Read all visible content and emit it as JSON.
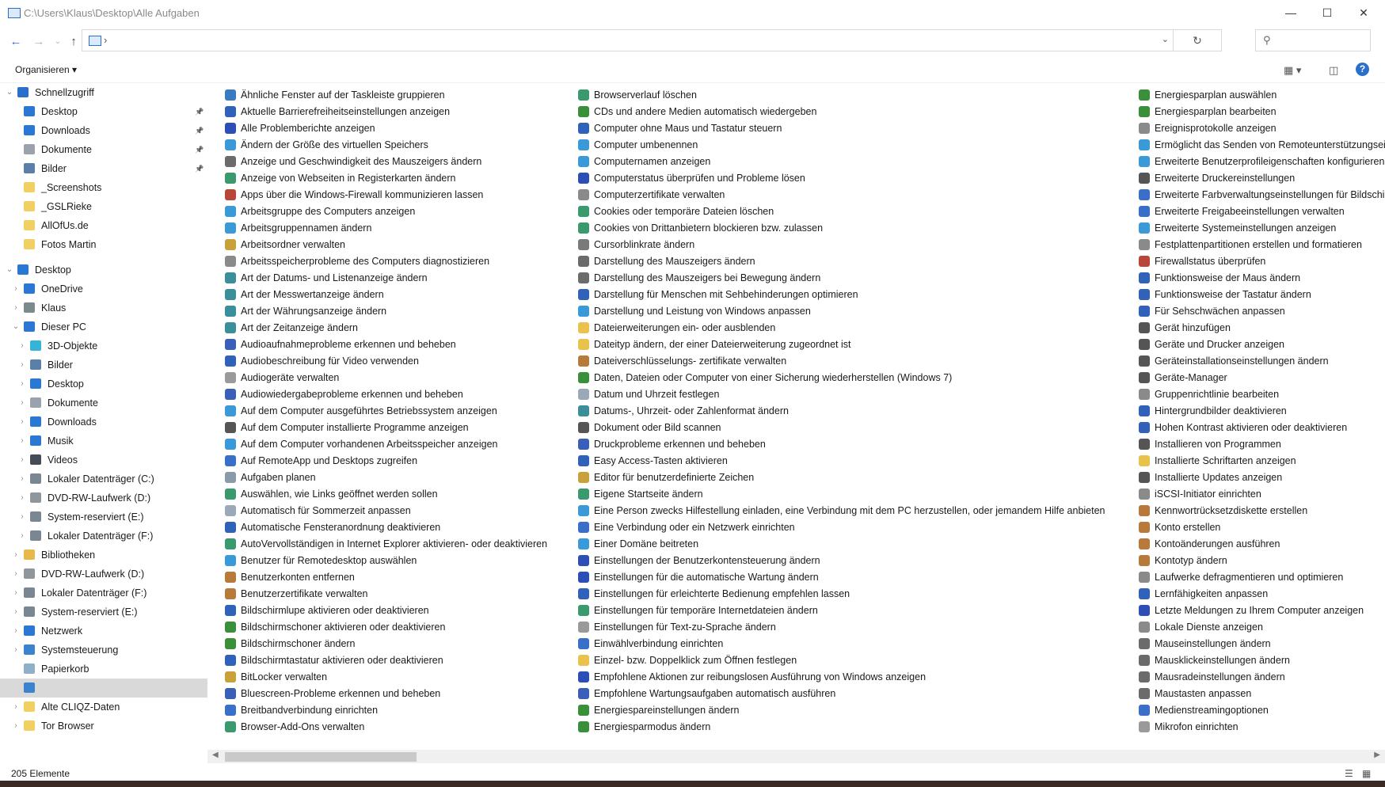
{
  "window": {
    "title": "C:\\Users\\Klaus\\Desktop\\Alle Aufgaben"
  },
  "address": {
    "separator": "›"
  },
  "toolbar": {
    "organize_label": "Organisieren ▾"
  },
  "nav": {
    "items": [
      {
        "label": "Schnellzugriff",
        "indent": 0,
        "chevron": "⌄",
        "icon": "star-icon",
        "color": "#2a6fc9",
        "pin": false
      },
      {
        "label": "Desktop",
        "indent": 1,
        "chevron": "",
        "icon": "desktop-icon",
        "color": "#2a78d4",
        "pin": true
      },
      {
        "label": "Downloads",
        "indent": 1,
        "chevron": "",
        "icon": "download-icon",
        "color": "#2a78d4",
        "pin": true
      },
      {
        "label": "Dokumente",
        "indent": 1,
        "chevron": "",
        "icon": "document-icon",
        "color": "#9aa3ad",
        "pin": true
      },
      {
        "label": "Bilder",
        "indent": 1,
        "chevron": "",
        "icon": "pictures-icon",
        "color": "#5a7fa8",
        "pin": true
      },
      {
        "label": "_Screenshots",
        "indent": 1,
        "chevron": "",
        "icon": "folder-icon",
        "color": "#f1cf63",
        "pin": false
      },
      {
        "label": "_GSLRieke",
        "indent": 1,
        "chevron": "",
        "icon": "folder-icon",
        "color": "#f1cf63",
        "pin": false
      },
      {
        "label": "AllOfUs.de",
        "indent": 1,
        "chevron": "",
        "icon": "folder-icon",
        "color": "#f1cf63",
        "pin": false
      },
      {
        "label": "Fotos Martin",
        "indent": 1,
        "chevron": "",
        "icon": "folder-icon",
        "color": "#f1cf63",
        "pin": false
      },
      {
        "label": "Desktop",
        "indent": 0,
        "chevron": "⌄",
        "icon": "desktop-icon",
        "color": "#2a78d4",
        "pin": false,
        "gap": true
      },
      {
        "label": "OneDrive",
        "indent": 1,
        "chevron": "›",
        "icon": "cloud-icon",
        "color": "#2a78d4",
        "pin": false
      },
      {
        "label": "Klaus",
        "indent": 1,
        "chevron": "›",
        "icon": "user-icon",
        "color": "#7b8a8c",
        "pin": false
      },
      {
        "label": "Dieser PC",
        "indent": 1,
        "chevron": "⌄",
        "icon": "computer-icon",
        "color": "#2a78d4",
        "pin": false
      },
      {
        "label": "3D-Objekte",
        "indent": 2,
        "chevron": "›",
        "icon": "cube-icon",
        "color": "#36b3d9",
        "pin": false
      },
      {
        "label": "Bilder",
        "indent": 2,
        "chevron": "›",
        "icon": "pictures-icon",
        "color": "#5a7fa8",
        "pin": false
      },
      {
        "label": "Desktop",
        "indent": 2,
        "chevron": "›",
        "icon": "desktop-icon",
        "color": "#2a78d4",
        "pin": false
      },
      {
        "label": "Dokumente",
        "indent": 2,
        "chevron": "›",
        "icon": "document-icon",
        "color": "#9aa3ad",
        "pin": false
      },
      {
        "label": "Downloads",
        "indent": 2,
        "chevron": "›",
        "icon": "download-icon",
        "color": "#2a78d4",
        "pin": false
      },
      {
        "label": "Musik",
        "indent": 2,
        "chevron": "›",
        "icon": "music-icon",
        "color": "#2a78d4",
        "pin": false
      },
      {
        "label": "Videos",
        "indent": 2,
        "chevron": "›",
        "icon": "video-icon",
        "color": "#444c55",
        "pin": false
      },
      {
        "label": "Lokaler Datenträger (C:)",
        "indent": 2,
        "chevron": "›",
        "icon": "drive-icon",
        "color": "#7a8691",
        "pin": false
      },
      {
        "label": "DVD-RW-Laufwerk (D:)",
        "indent": 2,
        "chevron": "›",
        "icon": "dvd-icon",
        "color": "#8f969c",
        "pin": false
      },
      {
        "label": "System-reserviert (E:)",
        "indent": 2,
        "chevron": "›",
        "icon": "drive-icon",
        "color": "#7a8691",
        "pin": false
      },
      {
        "label": "Lokaler Datenträger (F:)",
        "indent": 2,
        "chevron": "›",
        "icon": "drive-icon",
        "color": "#7a8691",
        "pin": false
      },
      {
        "label": "Bibliotheken",
        "indent": 1,
        "chevron": "›",
        "icon": "library-icon",
        "color": "#e8b94a",
        "pin": false
      },
      {
        "label": "DVD-RW-Laufwerk (D:)",
        "indent": 1,
        "chevron": "›",
        "icon": "dvd-icon",
        "color": "#8f969c",
        "pin": false
      },
      {
        "label": "Lokaler Datenträger (F:)",
        "indent": 1,
        "chevron": "›",
        "icon": "drive-icon",
        "color": "#7a8691",
        "pin": false
      },
      {
        "label": "System-reserviert (E:)",
        "indent": 1,
        "chevron": "›",
        "icon": "drive-icon",
        "color": "#7a8691",
        "pin": false
      },
      {
        "label": "Netzwerk",
        "indent": 1,
        "chevron": "›",
        "icon": "network-icon",
        "color": "#2a78d4",
        "pin": false
      },
      {
        "label": "Systemsteuerung",
        "indent": 1,
        "chevron": "›",
        "icon": "control-panel-icon",
        "color": "#3b83cc",
        "pin": false
      },
      {
        "label": "Papierkorb",
        "indent": 1,
        "chevron": "",
        "icon": "recycle-bin-icon",
        "color": "#8fb0c9",
        "pin": false
      },
      {
        "label": "",
        "indent": 1,
        "chevron": "",
        "icon": "control-panel-icon",
        "color": "#3b83cc",
        "pin": false,
        "selected": true
      },
      {
        "label": "Alte CLIQZ-Daten",
        "indent": 1,
        "chevron": "›",
        "icon": "folder-icon",
        "color": "#f1cf63",
        "pin": false
      },
      {
        "label": "Tor Browser",
        "indent": 1,
        "chevron": "›",
        "icon": "folder-icon",
        "color": "#f1cf63",
        "pin": false
      }
    ]
  },
  "columns": [
    {
      "items": [
        {
          "label": "Ähnliche Fenster auf der Taskleiste gruppieren",
          "color": "#3a7ac2"
        },
        {
          "label": "Aktuelle Barrierefreiheitseinstellungen anzeigen",
          "color": "#2f62b8"
        },
        {
          "label": "Alle Problemberichte anzeigen",
          "color": "#2d4fb5"
        },
        {
          "label": "Ändern der Größe des virtuellen Speichers",
          "color": "#3a9ad8"
        },
        {
          "label": "Anzeige und Geschwindigkeit des Mauszeigers ändern",
          "color": "#6b6b6b"
        },
        {
          "label": "Anzeige von Webseiten in Registerkarten ändern",
          "color": "#3a9a6e"
        },
        {
          "label": "Apps über die Windows-Firewall kommunizieren lassen",
          "color": "#b8473a"
        },
        {
          "label": "Arbeitsgruppe des Computers anzeigen",
          "color": "#3a9ad8"
        },
        {
          "label": "Arbeitsgruppennamen ändern",
          "color": "#3a9ad8"
        },
        {
          "label": "Arbeitsordner verwalten",
          "color": "#c9a13a"
        },
        {
          "label": "Arbeitsspeicherprobleme des Computers diagnostizieren",
          "color": "#8a8a8a"
        },
        {
          "label": "Art der Datums- und Listenanzeige ändern",
          "color": "#3a8f9a"
        },
        {
          "label": "Art der Messwertanzeige ändern",
          "color": "#3a8f9a"
        },
        {
          "label": "Art der Währungsanzeige ändern",
          "color": "#3a8f9a"
        },
        {
          "label": "Art der Zeitanzeige ändern",
          "color": "#3a8f9a"
        },
        {
          "label": "Audioaufnahmeprobleme erkennen und beheben",
          "color": "#3a5fb8"
        },
        {
          "label": "Audiobeschreibung für Video verwenden",
          "color": "#2f62b8"
        },
        {
          "label": "Audiogeräte verwalten",
          "color": "#9a9a9a"
        },
        {
          "label": "Audiowiedergabeprobleme erkennen und beheben",
          "color": "#3a5fb8"
        },
        {
          "label": "Auf dem Computer ausgeführtes Betriebssystem anzeigen",
          "color": "#3a9ad8"
        },
        {
          "label": "Auf dem Computer installierte Programme anzeigen",
          "color": "#555555"
        },
        {
          "label": "Auf dem Computer vorhandenen Arbeitsspeicher anzeigen",
          "color": "#3a9ad8"
        },
        {
          "label": "Auf RemoteApp und Desktops zugreifen",
          "color": "#3a6fc9"
        },
        {
          "label": "Aufgaben planen",
          "color": "#8a9aa8"
        },
        {
          "label": "Auswählen, wie Links geöffnet werden sollen",
          "color": "#3a9a6e"
        },
        {
          "label": "Automatisch für Sommerzeit anpassen",
          "color": "#9aa8b8"
        },
        {
          "label": "Automatische Fensteranordnung deaktivieren",
          "color": "#2f62b8"
        },
        {
          "label": "AutoVervollständigen in Internet Explorer aktivieren- oder deaktivieren",
          "color": "#3a9a6e"
        },
        {
          "label": "Benutzer für Remotedesktop auswählen",
          "color": "#3a9ad8"
        },
        {
          "label": "Benutzerkonten entfernen",
          "color": "#b87a3a"
        },
        {
          "label": "Benutzerzertifikate verwalten",
          "color": "#b87a3a"
        },
        {
          "label": "Bildschirmlupe aktivieren oder deaktivieren",
          "color": "#2f62b8"
        },
        {
          "label": "Bildschirmschoner aktivieren oder deaktivieren",
          "color": "#3a8f3a"
        },
        {
          "label": "Bildschirmschoner ändern",
          "color": "#3a8f3a"
        },
        {
          "label": "Bildschirmtastatur aktivieren oder deaktivieren",
          "color": "#2f62b8"
        },
        {
          "label": "BitLocker verwalten",
          "color": "#c9a13a"
        },
        {
          "label": "Bluescreen-Probleme erkennen und beheben",
          "color": "#3a5fb8"
        },
        {
          "label": "Breitbandverbindung einrichten",
          "color": "#3a6fc9"
        },
        {
          "label": "Browser-Add-Ons verwalten",
          "color": "#3a9a6e"
        }
      ]
    },
    {
      "items": [
        {
          "label": "Browserverlauf löschen",
          "color": "#3a9a6e"
        },
        {
          "label": "CDs und andere Medien automatisch wiedergeben",
          "color": "#3a8f3a"
        },
        {
          "label": "Computer ohne Maus und Tastatur steuern",
          "color": "#2f62b8"
        },
        {
          "label": "Computer umbenennen",
          "color": "#3a9ad8"
        },
        {
          "label": "Computernamen anzeigen",
          "color": "#3a9ad8"
        },
        {
          "label": "Computerstatus überprüfen und Probleme lösen",
          "color": "#2d4fb5"
        },
        {
          "label": "Computerzertifikate verwalten",
          "color": "#8a8a8a"
        },
        {
          "label": "Cookies oder temporäre Dateien löschen",
          "color": "#3a9a6e"
        },
        {
          "label": "Cookies von Drittanbietern blockieren bzw. zulassen",
          "color": "#3a9a6e"
        },
        {
          "label": "Cursorblinkrate ändern",
          "color": "#7a7a7a"
        },
        {
          "label": "Darstellung des Mauszeigers ändern",
          "color": "#6b6b6b"
        },
        {
          "label": "Darstellung des Mauszeigers bei Bewegung ändern",
          "color": "#6b6b6b"
        },
        {
          "label": "Darstellung für Menschen mit Sehbehinderungen optimieren",
          "color": "#2f62b8"
        },
        {
          "label": "Darstellung und Leistung von Windows anpassen",
          "color": "#3a9ad8"
        },
        {
          "label": "Dateierweiterungen ein- oder ausblenden",
          "color": "#e8c24a"
        },
        {
          "label": "Dateityp ändern, der einer Dateierweiterung zugeordnet ist",
          "color": "#e8c24a"
        },
        {
          "label": "Dateiverschlüsselungs- zertifikate verwalten",
          "color": "#b87a3a"
        },
        {
          "label": "Daten, Dateien oder Computer von einer Sicherung wiederherstellen (Windows 7)",
          "color": "#3a8f3a"
        },
        {
          "label": "Datum und Uhrzeit festlegen",
          "color": "#9aa8b8"
        },
        {
          "label": "Datums-, Uhrzeit- oder Zahlenformat ändern",
          "color": "#3a8f9a"
        },
        {
          "label": "Dokument oder Bild scannen",
          "color": "#555555"
        },
        {
          "label": "Druckprobleme erkennen und beheben",
          "color": "#3a5fb8"
        },
        {
          "label": "Easy Access-Tasten aktivieren",
          "color": "#2f62b8"
        },
        {
          "label": "Editor für benutzerdefinierte Zeichen",
          "color": "#c9a13a"
        },
        {
          "label": "Eigene Startseite ändern",
          "color": "#3a9a6e"
        },
        {
          "label": "Eine Person zwecks Hilfestellung einladen, eine Verbindung mit dem PC herzustellen, oder jemandem Hilfe anbieten",
          "color": "#3a9ad8"
        },
        {
          "label": "Eine Verbindung oder ein Netzwerk einrichten",
          "color": "#3a6fc9"
        },
        {
          "label": "Einer Domäne beitreten",
          "color": "#3a9ad8"
        },
        {
          "label": "Einstellungen der Benutzerkontensteuerung ändern",
          "color": "#2d4fb5"
        },
        {
          "label": "Einstellungen für die automatische Wartung ändern",
          "color": "#2d4fb5"
        },
        {
          "label": "Einstellungen für erleichterte Bedienung empfehlen lassen",
          "color": "#2f62b8"
        },
        {
          "label": "Einstellungen für temporäre Internetdateien ändern",
          "color": "#3a9a6e"
        },
        {
          "label": "Einstellungen für Text-zu-Sprache ändern",
          "color": "#9a9a9a"
        },
        {
          "label": "Einwählverbindung einrichten",
          "color": "#3a6fc9"
        },
        {
          "label": "Einzel- bzw. Doppelklick zum Öffnen festlegen",
          "color": "#e8c24a"
        },
        {
          "label": "Empfohlene Aktionen zur reibungslosen Ausführung von Windows anzeigen",
          "color": "#2d4fb5"
        },
        {
          "label": "Empfohlene Wartungsaufgaben automatisch ausführen",
          "color": "#3a5fb8"
        },
        {
          "label": "Energiespareinstellungen ändern",
          "color": "#3a8f3a"
        },
        {
          "label": "Energiesparmodus ändern",
          "color": "#3a8f3a"
        }
      ]
    },
    {
      "items": [
        {
          "label": "Energiesparplan auswählen",
          "color": "#3a8f3a"
        },
        {
          "label": "Energiesparplan bearbeiten",
          "color": "#3a8f3a"
        },
        {
          "label": "Ereignisprotokolle anzeigen",
          "color": "#8a8a8a"
        },
        {
          "label": "Ermöglicht das Senden von Remoteunterstützungseinladungen",
          "color": "#3a9ad8"
        },
        {
          "label": "Erweiterte Benutzerprofileigenschaften konfigurieren",
          "color": "#3a9ad8"
        },
        {
          "label": "Erweiterte Druckereinstellungen",
          "color": "#555555"
        },
        {
          "label": "Erweiterte Farbverwaltungseinstellungen für Bildschirme, Scanner und Drucker ändern",
          "color": "#3a6fc9"
        },
        {
          "label": "Erweiterte Freigabeeinstellungen verwalten",
          "color": "#3a6fc9"
        },
        {
          "label": "Erweiterte Systemeinstellungen anzeigen",
          "color": "#3a9ad8"
        },
        {
          "label": "Festplattenpartitionen erstellen und formatieren",
          "color": "#8a8a8a"
        },
        {
          "label": "Firewallstatus überprüfen",
          "color": "#b8473a"
        },
        {
          "label": "Funktionsweise der Maus ändern",
          "color": "#2f62b8"
        },
        {
          "label": "Funktionsweise der Tastatur ändern",
          "color": "#2f62b8"
        },
        {
          "label": "Für Sehschwächen anpassen",
          "color": "#2f62b8"
        },
        {
          "label": "Gerät hinzufügen",
          "color": "#555555"
        },
        {
          "label": "Geräte und Drucker anzeigen",
          "color": "#555555"
        },
        {
          "label": "Geräteinstallationseinstellungen ändern",
          "color": "#555555"
        },
        {
          "label": "Geräte-Manager",
          "color": "#555555"
        },
        {
          "label": "Gruppenrichtlinie bearbeiten",
          "color": "#8a8a8a"
        },
        {
          "label": "Hintergrundbilder deaktivieren",
          "color": "#2f62b8"
        },
        {
          "label": "Hohen Kontrast aktivieren oder deaktivieren",
          "color": "#2f62b8"
        },
        {
          "label": "Installieren von Programmen",
          "color": "#555555"
        },
        {
          "label": "Installierte Schriftarten anzeigen",
          "color": "#e8c24a"
        },
        {
          "label": "Installierte Updates anzeigen",
          "color": "#555555"
        },
        {
          "label": "iSCSI-Initiator einrichten",
          "color": "#8a8a8a"
        },
        {
          "label": "Kennwortrücksetzdiskette erstellen",
          "color": "#b87a3a"
        },
        {
          "label": "Konto erstellen",
          "color": "#b87a3a"
        },
        {
          "label": "Kontoänderungen ausführen",
          "color": "#b87a3a"
        },
        {
          "label": "Kontotyp ändern",
          "color": "#b87a3a"
        },
        {
          "label": "Laufwerke defragmentieren und optimieren",
          "color": "#8a8a8a"
        },
        {
          "label": "Lernfähigkeiten anpassen",
          "color": "#2f62b8"
        },
        {
          "label": "Letzte Meldungen zu Ihrem Computer anzeigen",
          "color": "#2d4fb5"
        },
        {
          "label": "Lokale Dienste anzeigen",
          "color": "#8a8a8a"
        },
        {
          "label": "Mauseinstellungen ändern",
          "color": "#6b6b6b"
        },
        {
          "label": "Mausklickeinstellungen ändern",
          "color": "#6b6b6b"
        },
        {
          "label": "Mausradeinstellungen ändern",
          "color": "#6b6b6b"
        },
        {
          "label": "Maustasten anpassen",
          "color": "#6b6b6b"
        },
        {
          "label": "Medienstreamingoptionen",
          "color": "#3a6fc9"
        },
        {
          "label": "Mikrofon einrichten",
          "color": "#9a9a9a"
        }
      ]
    }
  ],
  "status": {
    "count_label": "205 Elemente"
  }
}
